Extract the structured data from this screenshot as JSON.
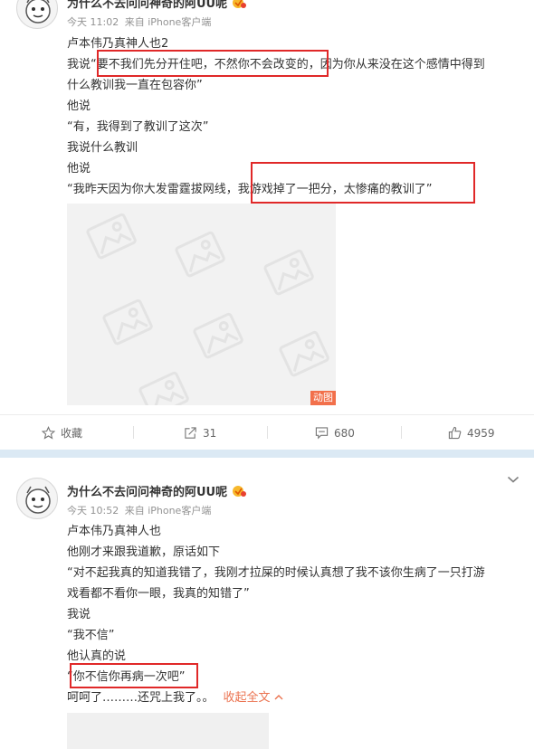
{
  "post1": {
    "author": "为什么不去问问神奇的阿UU呢",
    "time": "今天 11:02",
    "source": "来自 iPhone客户端",
    "lines": [
      "卢本伟乃真神人也2",
      "我说“要不我们先分开住吧，不然你不会改变的，因为你从来没在这个感情中得到",
      "什么教训我一直在包容你”",
      "他说",
      "“有，我得到了教训了这次”",
      "我说什么教训",
      "他说",
      "“我昨天因为你大发雷霆拔网线，我游戏掉了一把分，太惨痛的教训了”"
    ],
    "image_badge": "动图",
    "actions": {
      "favorite": "收藏",
      "repost": "31",
      "comment": "680",
      "like": "4959"
    }
  },
  "post2": {
    "author": "为什么不去问问神奇的阿UU呢",
    "time": "今天 10:52",
    "source": "来自 iPhone客户端",
    "lines": [
      "卢本伟乃真神人也",
      "他刚才来跟我道歉，原话如下",
      "“对不起我真的知道我错了，我刚才拉屎的时候认真想了我不该你生病了一只打游",
      "戏看都不看你一眼，我真的知错了”",
      "我说",
      "“我不信”",
      "他认真的说",
      "“你不信你再病一次吧”"
    ],
    "last_line": "呵呵了………还咒上我了。。",
    "collapse_label": "收起全文"
  },
  "colors": {
    "highlight_box": "#e02828",
    "accent": "#eb7350",
    "separator": "#dbe9f4"
  }
}
